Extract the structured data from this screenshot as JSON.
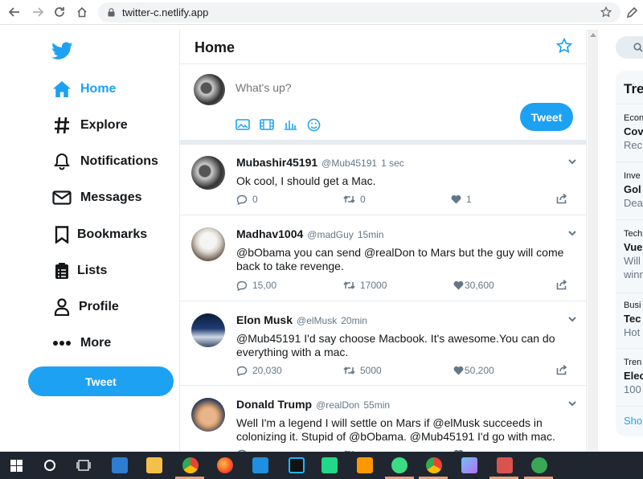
{
  "browser": {
    "url": "twitter-c.netlify.app"
  },
  "sidebar": {
    "items": [
      {
        "label": "Home",
        "icon": "home-icon",
        "active": true
      },
      {
        "label": "Explore",
        "icon": "hashtag-icon"
      },
      {
        "label": "Notifications",
        "icon": "bell-icon"
      },
      {
        "label": "Messages",
        "icon": "envelope-icon"
      },
      {
        "label": "Bookmarks",
        "icon": "bookmark-icon"
      },
      {
        "label": "Lists",
        "icon": "list-icon"
      },
      {
        "label": "Profile",
        "icon": "user-icon"
      },
      {
        "label": "More",
        "icon": "more-dots-icon"
      }
    ],
    "tweet_button": "Tweet"
  },
  "main": {
    "title": "Home",
    "compose": {
      "placeholder": "What's up?",
      "tweet_button": "Tweet"
    },
    "tweets": [
      {
        "name": "Mubashir45191",
        "handle": "@Mub45191",
        "time": "1 sec",
        "text": "Ok cool, I should get a Mac.",
        "replies": "0",
        "retweets": "0",
        "likes": "1"
      },
      {
        "name": "Madhav1004",
        "handle": "@madGuy",
        "time": "15min",
        "text": "@bObama you can send @realDon to Mars but the guy will come back to take revenge.",
        "replies": "15,00",
        "retweets": "17000",
        "likes": "30,600"
      },
      {
        "name": "Elon Musk",
        "handle": "@elMusk",
        "time": "20min",
        "text": "@Mub45191 I'd say choose Macbook. It's awesome.You can do everything with a mac.",
        "replies": "20,030",
        "retweets": "5000",
        "likes": "50,200"
      },
      {
        "name": "Donald Trump",
        "handle": "@realDon",
        "time": "55min",
        "text": "Well I'm a legend I will settle on Mars if @elMusk succeeds in colonizing it. Stupid of @bObama. @Mub45191 I'd go with mac.",
        "replies": "",
        "retweets": "",
        "likes": ""
      }
    ]
  },
  "right": {
    "title": "Tre",
    "trends": [
      {
        "category": "Econ",
        "title": "Cov",
        "sub": "Rec"
      },
      {
        "category": "Inve",
        "title": "Gol",
        "sub": "Dea"
      },
      {
        "category": "Tech",
        "title": "Vue",
        "sub": "Will",
        "sub2": "winn"
      },
      {
        "category": "Busi",
        "title": "Tec",
        "sub": "Hot"
      },
      {
        "category": "Tren",
        "title": "Elec",
        "sub": "100"
      }
    ],
    "show_more": "Sho"
  },
  "colors": {
    "accent": "#1da1f2",
    "text": "#14171a",
    "muted": "#657786",
    "taskbar": "#1f2630"
  }
}
